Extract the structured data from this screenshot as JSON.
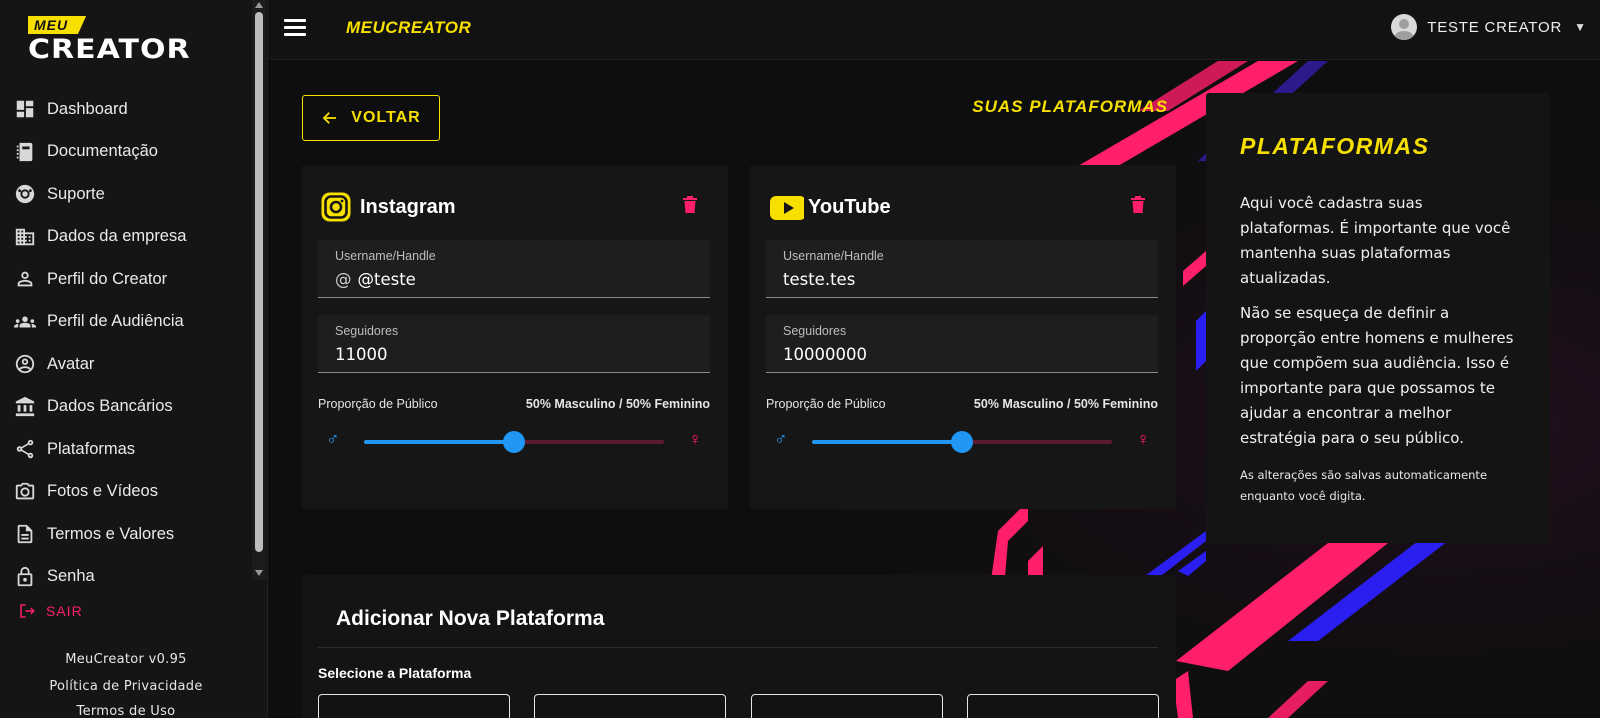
{
  "brand": {
    "logo_small": "MEU",
    "logo_main": "CREATOR",
    "topbar_title": "MEUCREATOR"
  },
  "sidebar": {
    "items": [
      {
        "label": "Dashboard",
        "icon": "dashboard-icon"
      },
      {
        "label": "Documentação",
        "icon": "book-icon"
      },
      {
        "label": "Suporte",
        "icon": "lifebuoy-icon"
      },
      {
        "label": "Dados da empresa",
        "icon": "building-icon"
      },
      {
        "label": "Perfil do Creator",
        "icon": "person-icon"
      },
      {
        "label": "Perfil de Audiência",
        "icon": "group-icon"
      },
      {
        "label": "Avatar",
        "icon": "account-circle-icon"
      },
      {
        "label": "Dados Bancários",
        "icon": "bank-icon"
      },
      {
        "label": "Plataformas",
        "icon": "share-icon"
      },
      {
        "label": "Fotos e Vídeos",
        "icon": "camera-icon"
      },
      {
        "label": "Termos e Valores",
        "icon": "document-icon"
      },
      {
        "label": "Senha",
        "icon": "lock-icon"
      }
    ],
    "logout": "SAIR",
    "version": "MeuCreator v0.95",
    "privacy": "Política de Privacidade",
    "terms": "Termos de Uso"
  },
  "user": {
    "name": "TESTE CREATOR"
  },
  "page": {
    "back_label": "VOLTAR",
    "title": "SUAS PLATAFORMAS"
  },
  "platforms": [
    {
      "name": "Instagram",
      "icon": "instagram-icon",
      "handle_label": "Username/Handle",
      "handle_prefix": "@",
      "handle": "@teste",
      "followers_label": "Seguidores",
      "followers": "11000",
      "proportion_label": "Proporção de Público",
      "proportion_text": "50% Masculino / 50% Feminino",
      "male_pct": 50
    },
    {
      "name": "YouTube",
      "icon": "youtube-icon",
      "handle_label": "Username/Handle",
      "handle_prefix": "",
      "handle": "teste.tes",
      "followers_label": "Seguidores",
      "followers": "10000000",
      "proportion_label": "Proporção de Público",
      "proportion_text": "50% Masculino / 50% Feminino",
      "male_pct": 50
    }
  ],
  "info": {
    "title": "PLATAFORMAS",
    "p1": "Aqui você cadastra suas plataformas. É importante que você mantenha suas plataformas atualizadas.",
    "p2": "Não se esqueça de definir a proporção entre homens e mulheres que compõem sua audiência. Isso é importante para que possamos te ajudar a encontrar a melhor estratégia para o seu público.",
    "note": "As alterações são salvas automaticamente enquanto você digita."
  },
  "add_platform": {
    "title": "Adicionar Nova Plataforma",
    "select_label": "Selecione a Plataforma"
  },
  "colors": {
    "accent": "#f7e000",
    "danger": "#ff1f6a",
    "male": "#2196f3",
    "female": "#ff1f6a"
  }
}
